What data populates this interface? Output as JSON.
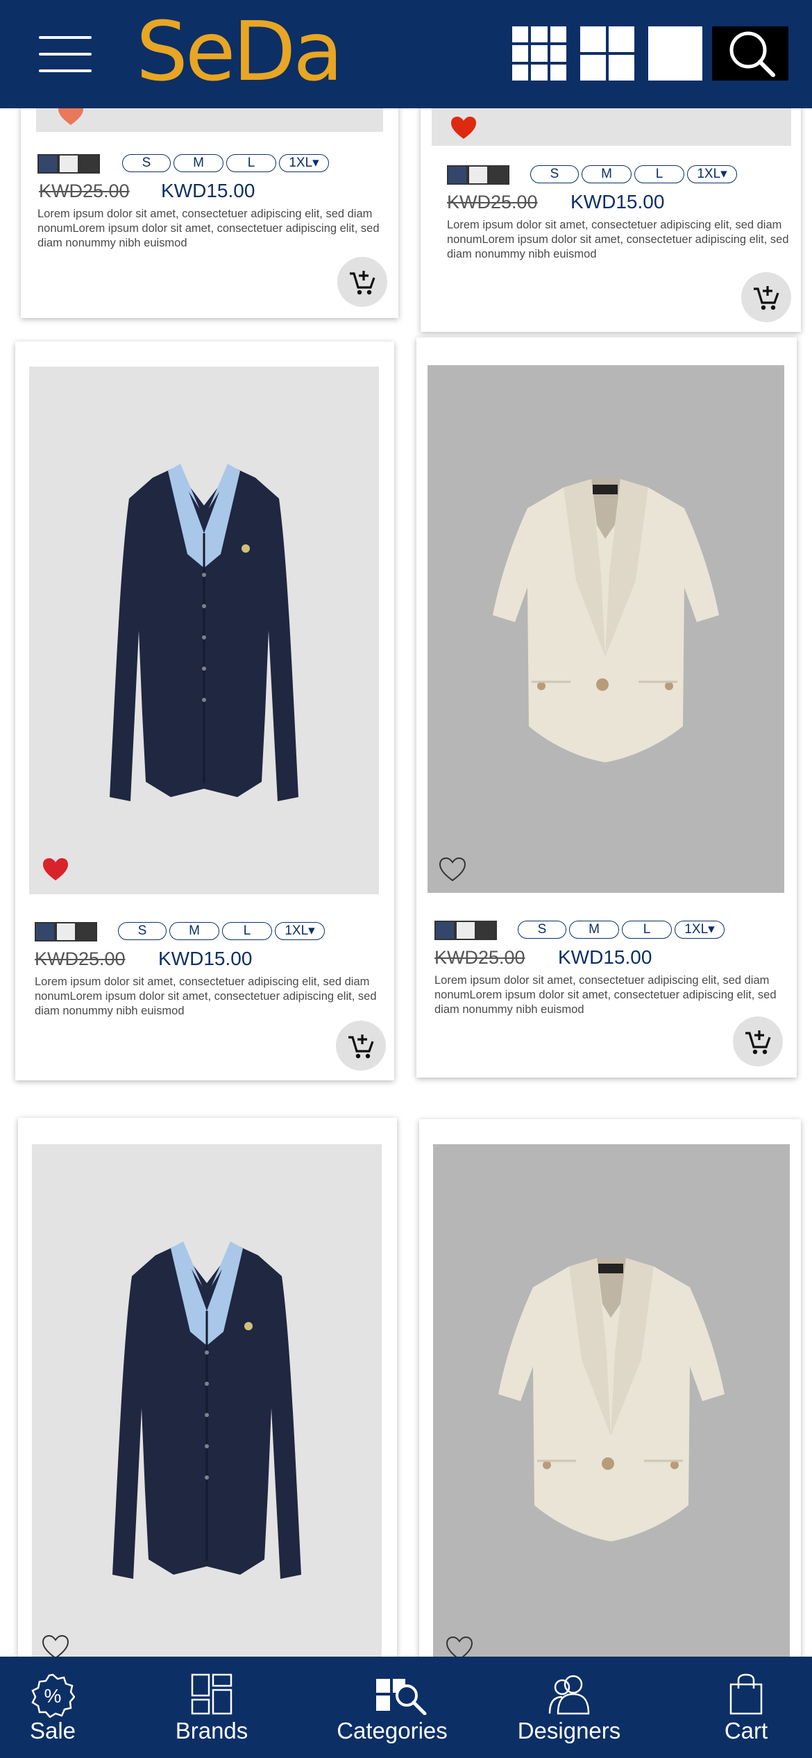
{
  "header": {
    "menu_icon": "hamburger-menu-icon",
    "logo": "SeDa",
    "view_icons": [
      "grid-9-icon",
      "grid-4-icon",
      "grid-1-icon"
    ],
    "search_icon": "search-icon"
  },
  "colors": {
    "brand": "#0c2f66",
    "logo": "#e8a623",
    "fav_filled": "#d9232b"
  },
  "products": [
    {
      "fav": "filled",
      "swatches": [
        "#34466b",
        "#ececec",
        "#363636"
      ],
      "sizes": [
        "S",
        "M",
        "L",
        "1XL▾"
      ],
      "old_price": "KWD25.00",
      "new_price": "KWD15.00",
      "desc": "Lorem ipsum dolor sit amet, consectetuer adipiscing elit, sed diam nonumLorem ipsum dolor sit amet, consectetuer adipiscing elit, sed diam nonummy nibh euismod"
    },
    {
      "fav": "filled",
      "swatches": [
        "#34466b",
        "#ececec",
        "#363636"
      ],
      "sizes": [
        "S",
        "M",
        "L",
        "1XL▾"
      ],
      "old_price": "KWD25.00",
      "new_price": "KWD15.00",
      "desc": "Lorem ipsum dolor sit amet, consectetuer adipiscing elit, sed diam nonumLorem ipsum dolor sit amet, consectetuer adipiscing elit, sed diam nonummy nibh euismod"
    },
    {
      "fav": "filled",
      "swatches": [
        "#34466b",
        "#ececec",
        "#363636"
      ],
      "sizes": [
        "S",
        "M",
        "L",
        "1XL▾"
      ],
      "old_price": "KWD25.00",
      "new_price": "KWD15.00",
      "desc": "Lorem ipsum dolor sit amet, consectetuer adipiscing elit, sed diam nonumLorem ipsum dolor sit amet, consectetuer adipiscing elit, sed diam nonummy nibh euismod"
    },
    {
      "fav": "outline",
      "swatches": [
        "#34466b",
        "#ececec",
        "#363636"
      ],
      "sizes": [
        "S",
        "M",
        "L",
        "1XL▾"
      ],
      "old_price": "KWD25.00",
      "new_price": "KWD15.00",
      "desc": "Lorem ipsum dolor sit amet, consectetuer adipiscing elit, sed diam nonumLorem ipsum dolor sit amet, consectetuer adipiscing elit, sed diam nonummy nibh euismod"
    },
    {
      "fav": "outline"
    },
    {
      "fav": "outline"
    }
  ],
  "bottom_nav": [
    {
      "label": "Sale",
      "icon": "sale-badge-icon"
    },
    {
      "label": "Brands",
      "icon": "brands-icon"
    },
    {
      "label": "Categories",
      "icon": "categories-icon"
    },
    {
      "label": "Designers",
      "icon": "designers-icon"
    },
    {
      "label": "Cart",
      "icon": "shopping-bag-icon"
    }
  ]
}
